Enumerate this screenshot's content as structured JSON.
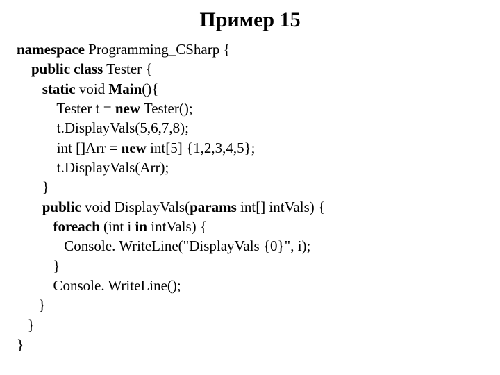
{
  "title": "Пример 15",
  "code": {
    "l1": {
      "kw": "namespace",
      "rest": " Programming_CSharp {"
    },
    "l2": {
      "kw": "public class",
      "rest": " Tester {"
    },
    "l3": {
      "kw1": "static",
      "mid": " void ",
      "kw2": "Main",
      "rest": "(){"
    },
    "l4": {
      "a": "Tester t = ",
      "kw": "new",
      "b": " Tester();"
    },
    "l5": "t.DisplayVals(5,6,7,8);",
    "l6": {
      "a": "int []Arr = ",
      "kw": "new",
      "b": " int[5] {1,2,3,4,5};"
    },
    "l7": "t.DisplayVals(Arr);",
    "l8": "}",
    "l9": {
      "kw1": "public",
      "mid": " void DisplayVals(",
      "kw2": "params",
      "rest": " int[] intVals) {"
    },
    "l10": {
      "kw1": "foreach",
      "mid": " (int i ",
      "kw2": "in",
      "rest": " intVals) {"
    },
    "l11": "Console. WriteLine(\"DisplayVals {0}\", i);",
    "l12": "}",
    "l13": "Console. WriteLine();",
    "l14": "}",
    "l15": "}",
    "l16": "}"
  }
}
